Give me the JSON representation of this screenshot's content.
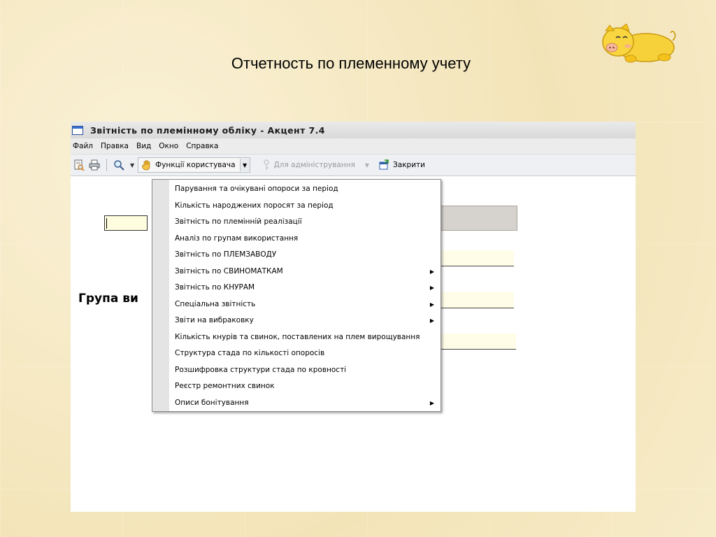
{
  "slide": {
    "title": "Отчетность по племенному учету"
  },
  "window": {
    "title": "Звітність по племінному обліку - Акцент 7.4",
    "menu": [
      "Файл",
      "Правка",
      "Вид",
      "Окно",
      "Справка"
    ],
    "toolbar": {
      "user_functions_label": "Функції користувача",
      "admin_label": "Для адміністрування",
      "close_label": "Закрити"
    },
    "content": {
      "group_label": "Група ви"
    }
  },
  "popup_menu": {
    "items": [
      {
        "label": "Парування та очікувані опороси за період",
        "submenu": false
      },
      {
        "label": "Кількість народжених поросят за період",
        "submenu": false
      },
      {
        "label": "Звітність по племінній реалізації",
        "submenu": false
      },
      {
        "label": "Аналіз по групам використання",
        "submenu": false
      },
      {
        "label": "Звітність по ПЛЕМЗАВОДУ",
        "submenu": false
      },
      {
        "label": "Звітність по СВИНОМАТКАМ",
        "submenu": true
      },
      {
        "label": "Звітність по КНУРАМ",
        "submenu": true
      },
      {
        "label": "Спеціальна звітність",
        "submenu": true
      },
      {
        "label": "Звіти на вибраковку",
        "submenu": true
      },
      {
        "label": "Кількість кнурів та свинок, поставлених на плем вирощування",
        "submenu": false
      },
      {
        "label": "Структура стада по кількості опоросів",
        "submenu": false
      },
      {
        "label": "Розшифровка структури стада по кровності",
        "submenu": false
      },
      {
        "label": "Реєстр ремонтних свинок",
        "submenu": false
      },
      {
        "label": "Описи бонітування",
        "submenu": true
      }
    ]
  },
  "icons": {
    "pig": "pig-mascot-icon",
    "print_preview": "print-preview-icon",
    "print": "printer-icon",
    "search": "magnifier-icon",
    "user_functions": "hand-icon",
    "admin": "key-icon",
    "close": "close-window-icon"
  }
}
